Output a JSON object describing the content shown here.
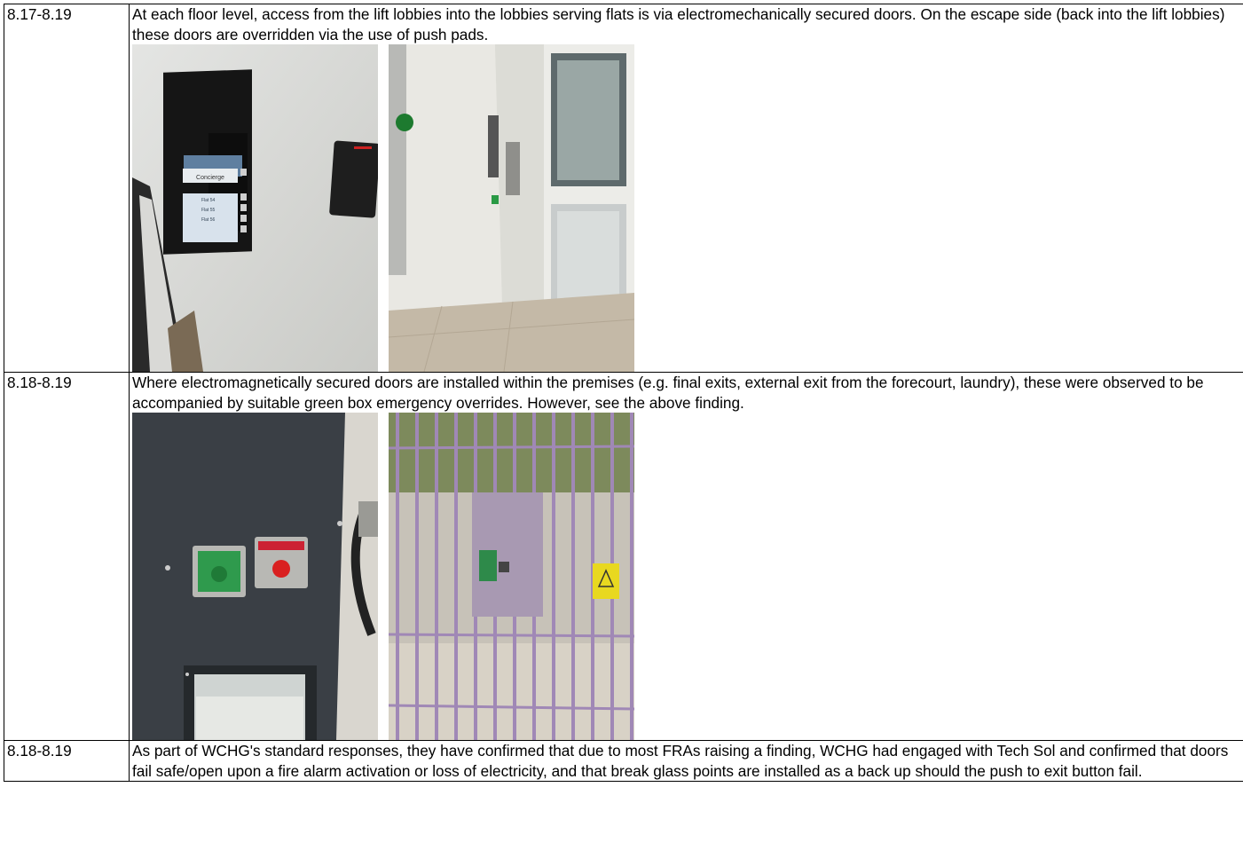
{
  "rows": [
    {
      "ref": "8.17-8.19",
      "text": "At each floor level, access from the lift lobbies into the lobbies serving flats is via electromechanically secured doors. On the escape side (back into the lift lobbies) these doors are overridden via the use of push pads.",
      "photo_labels": [
        "Concierge",
        "Flat 54",
        "Flat 55",
        "Flat 56"
      ]
    },
    {
      "ref": "8.18-8.19",
      "text": "Where electromagnetically secured doors are installed within the premises (e.g. final exits, external exit from the forecourt, laundry), these were observed to be accompanied by suitable green box emergency overrides. However, see the above finding."
    },
    {
      "ref": "8.18-8.19",
      "text": "As part of WCHG's standard responses, they have confirmed that due to most FRAs raising a finding, WCHG had engaged with Tech Sol and confirmed that doors fail safe/open upon a fire alarm activation or loss of electricity, and that break glass points are installed as a back up should the push to exit button fail."
    }
  ]
}
